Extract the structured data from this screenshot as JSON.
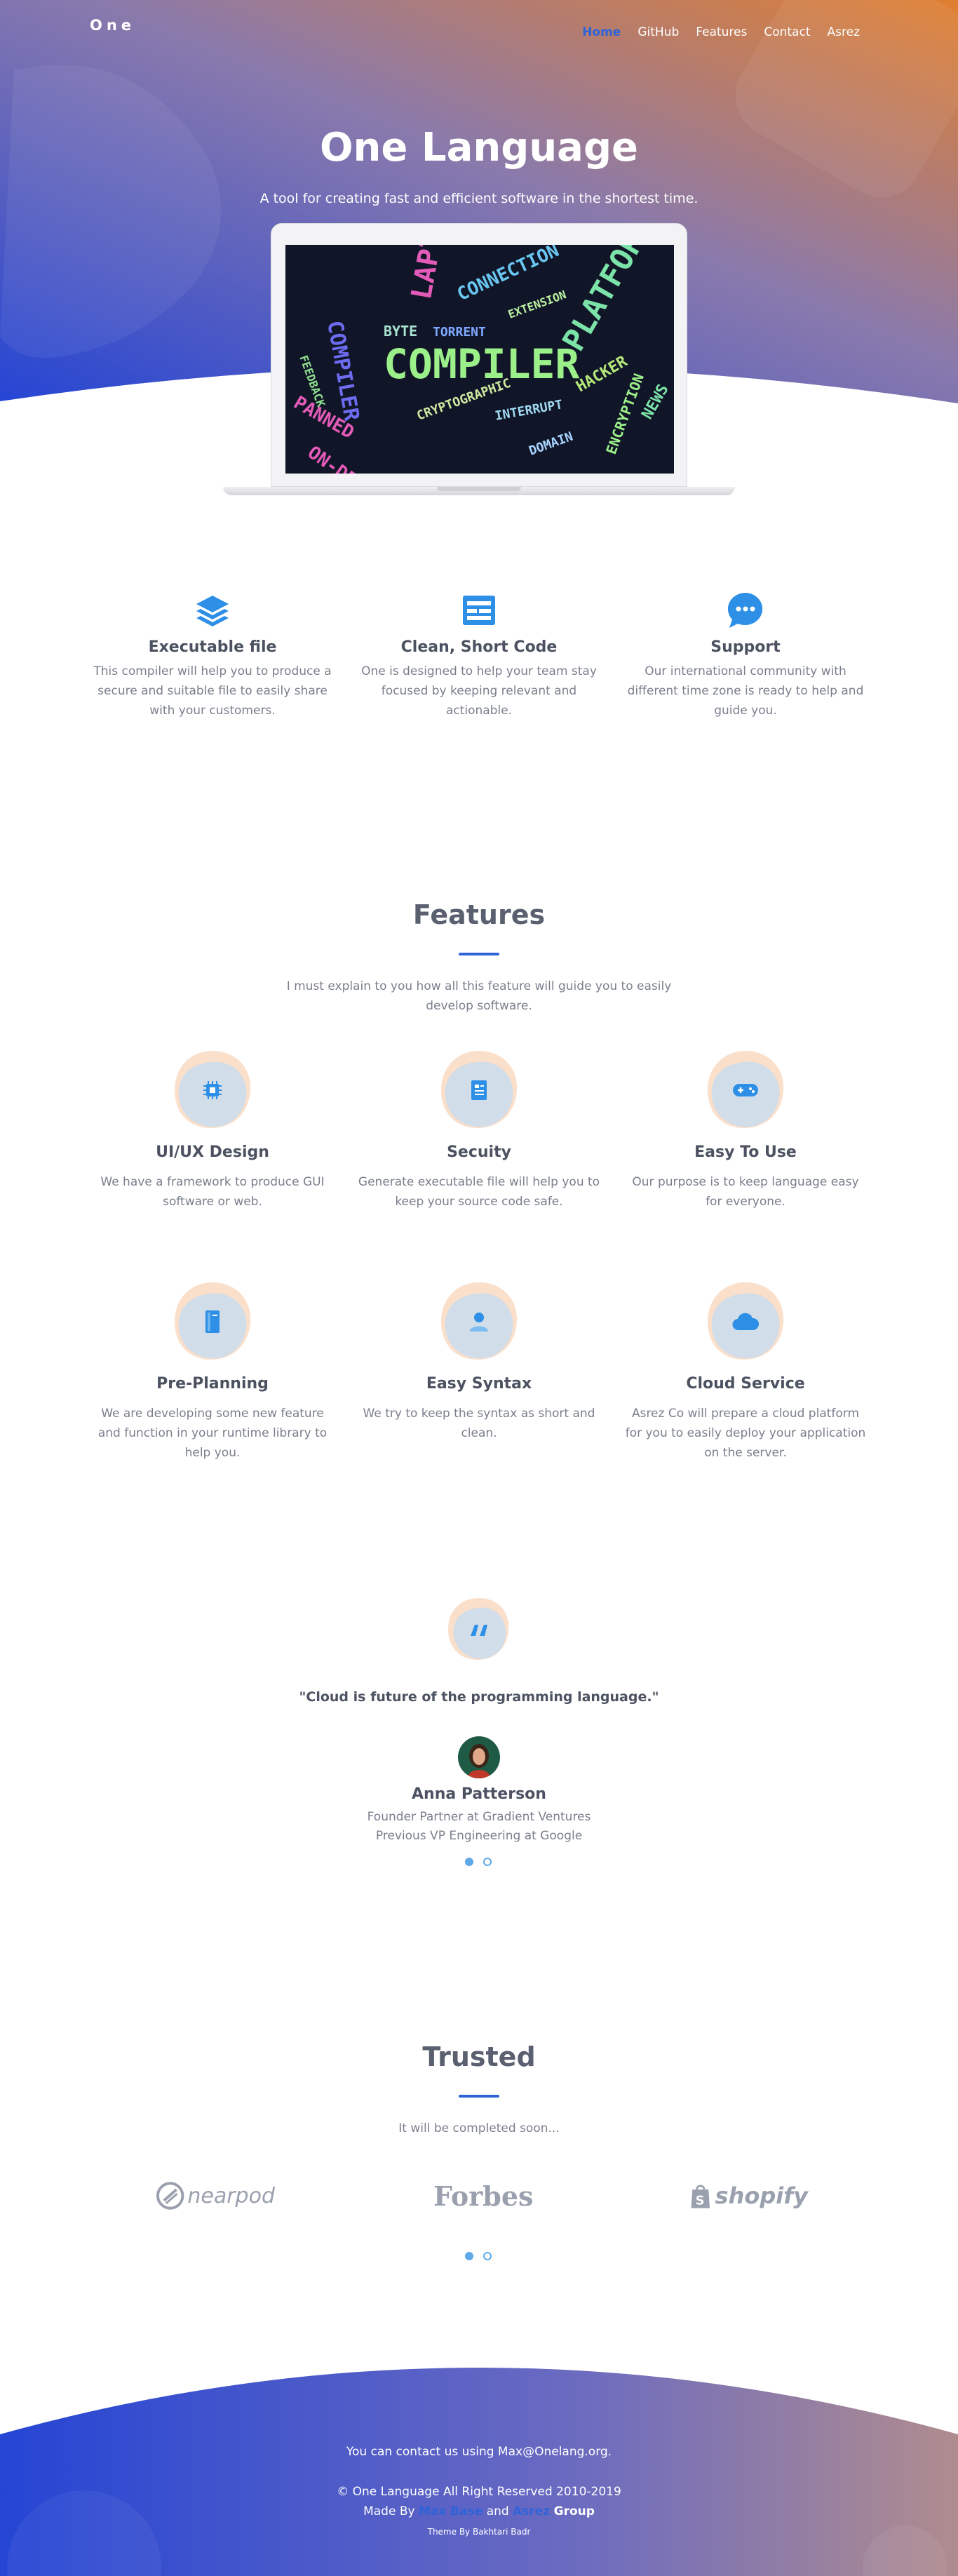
{
  "colors": {
    "accent": "#2f63d8",
    "hero_start": "#2a4ed6",
    "hero_end": "#d9803a",
    "icon_blue": "#2d8fe6",
    "blob_peach": "#f8d2b4",
    "blob_blue": "#bfdcf5"
  },
  "nav": {
    "brand": "One",
    "links": [
      {
        "label": "Home",
        "active": true
      },
      {
        "label": "GitHub"
      },
      {
        "label": "Features"
      },
      {
        "label": "Contact"
      },
      {
        "label": "Asrez"
      }
    ]
  },
  "hero": {
    "title": "One Language",
    "subtitle": "A tool for creating fast and efficient software in the shortest time.",
    "screen_words": [
      "COMPILER",
      "LAPTOP",
      "PLATFORM",
      "CONNECTION",
      "HACKER",
      "BYTE",
      "TORRENT",
      "EXTENSION",
      "CRYPTOGRAPHIC",
      "INTERRUPT",
      "FEEDBACK",
      "ON-DEMAND",
      "PANNED"
    ]
  },
  "services": [
    {
      "icon": "layers-icon",
      "title": "Executable file",
      "text": "This compiler will help you to produce a secure and suitable file to easily share with your customers."
    },
    {
      "icon": "browser-window-icon",
      "title": "Clean, Short Code",
      "text": "One is designed to help your team stay focused by keeping relevant and actionable."
    },
    {
      "icon": "chat-bubble-icon",
      "title": "Support",
      "text": "Our international community with different time zone is ready to help and guide you."
    }
  ],
  "features": {
    "title": "Features",
    "subtitle": "I must explain to you how all this feature will guide you to easily develop software.",
    "items": [
      {
        "icon": "chip-icon",
        "title": "UI/UX Design",
        "text": "We have a framework to produce GUI software or web."
      },
      {
        "icon": "document-icon",
        "title": "Secuity",
        "text": "Generate executable file will help you to keep your source code safe."
      },
      {
        "icon": "gamepad-icon",
        "title": "Easy To Use",
        "text": "Our purpose is to keep language easy for everyone."
      },
      {
        "icon": "book-icon",
        "title": "Pre-Planning",
        "text": "We are developing some new feature and function in your runtime library to help you."
      },
      {
        "icon": "user-icon",
        "title": "Easy Syntax",
        "text": "We try to keep the syntax as short and clean."
      },
      {
        "icon": "cloud-icon",
        "title": "Cloud Service",
        "text": "Asrez Co will prepare a cloud platform for you to easily deploy your application on the server."
      }
    ]
  },
  "testimonial": {
    "icon": "quote-icon",
    "quote": "\"Cloud is future of the programming language.\"",
    "name": "Anna Patterson",
    "role_1": "Founder Partner at Gradient Ventures",
    "role_2": "Previous VP Engineering at Google",
    "slide_count": 2,
    "active_slide": 1
  },
  "trusted": {
    "title": "Trusted",
    "subtitle": "It will be completed soon...",
    "logos": [
      "nearpod",
      "Forbes",
      "shopify"
    ],
    "slide_count": 2,
    "active_slide": 1
  },
  "footer": {
    "contact": "You can contact us using Max@Onelang.org.",
    "copyright": "© One Language All Right Reserved 2010-2019",
    "made_by_prefix": "Made By",
    "made_by_name": "Max Base",
    "made_by_and": "and",
    "made_by_group_name": "Asrez",
    "made_by_group_suffix": "Group",
    "theme": "Theme By Bakhtari Badr"
  }
}
